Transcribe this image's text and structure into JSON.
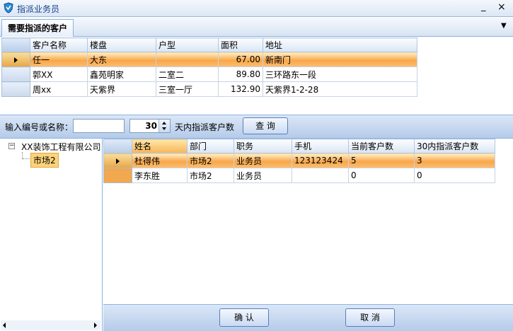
{
  "window": {
    "title": "指派业务员",
    "minimize_glyph": "_",
    "close_glyph": "×"
  },
  "tab": {
    "label": "需要指派的客户"
  },
  "customers": {
    "columns": [
      "客户名称",
      "楼盘",
      "户型",
      "面积",
      "地址"
    ],
    "rows": [
      {
        "name": "任一",
        "estate": "大东",
        "layout": "",
        "area": "67.00",
        "address": "新南门"
      },
      {
        "name": "郭XX",
        "estate": "鑫苑明家",
        "layout": "二室二",
        "area": "89.80",
        "address": "三环路东一段"
      },
      {
        "name": "周xx",
        "estate": "天紫界",
        "layout": "三室一厅",
        "area": "132.90",
        "address": "天紫界1-2-28"
      }
    ]
  },
  "search": {
    "label": "输入编号或名称：",
    "input_value": "",
    "days_value": "30",
    "days_label": "天内指派客户数",
    "query_button": "查 询"
  },
  "tree": {
    "root": "XX装饰工程有限公司",
    "child": "市场2",
    "toggle": "−"
  },
  "staff": {
    "columns": [
      "姓名",
      "部门",
      "职务",
      "手机",
      "当前客户数",
      "30内指派客户数"
    ],
    "rows": [
      {
        "name": "杜得伟",
        "dept": "市场2",
        "title": "业务员",
        "phone": "123123424",
        "current": "5",
        "assigned30": "3"
      },
      {
        "name": "李东胜",
        "dept": "市场2",
        "title": "业务员",
        "phone": "",
        "current": "0",
        "assigned30": "0"
      }
    ]
  },
  "footer": {
    "ok_button": "确 认",
    "cancel_button": "取 消"
  }
}
